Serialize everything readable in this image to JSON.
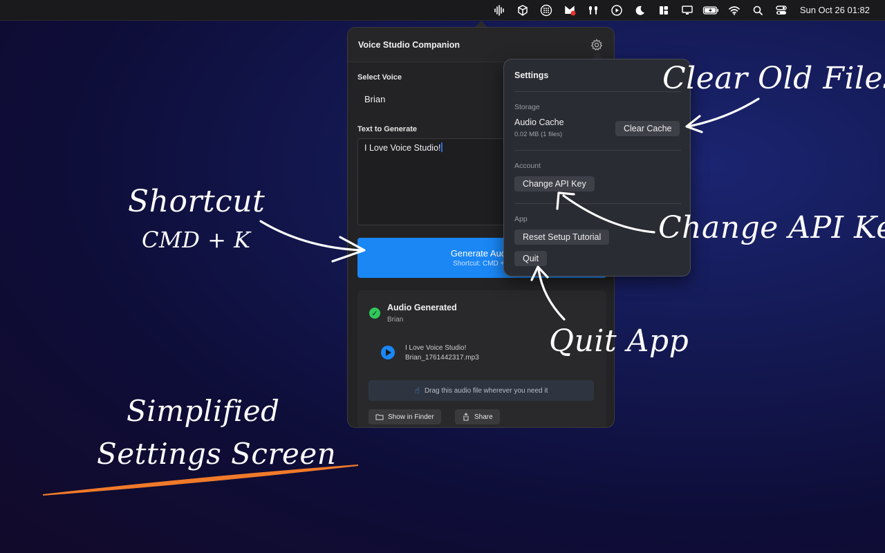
{
  "menubar": {
    "clock": "Sun Oct 26  01:82",
    "icons": [
      "waveform-icon",
      "cube-icon",
      "grid-icon",
      "app-icon",
      "airpods-icon",
      "play-circle-icon",
      "moon-icon",
      "layout-icon",
      "display-icon",
      "battery-icon",
      "wifi-icon",
      "search-icon",
      "control-center-icon"
    ]
  },
  "panel": {
    "title": "Voice Studio Companion",
    "select_label": "Select Voice",
    "voice": "Brian",
    "text_label": "Text to Generate",
    "text_value": "I Love Voice Studio!",
    "generate_label": "Generate Audio",
    "generate_sub": "Shortcut: CMD + K",
    "result": {
      "title": "Audio Generated",
      "voice": "Brian",
      "file_text": "I Love Voice Studio!",
      "file_name": "Brian_1761442317.mp3",
      "drag_hint": "Drag this audio file wherever you need it",
      "show_finder": "Show in Finder",
      "share": "Share"
    }
  },
  "settings": {
    "title": "Settings",
    "storage_label": "Storage",
    "cache_label": "Audio Cache",
    "cache_meta": "0.02 MB (1 files)",
    "clear_cache": "Clear Cache",
    "account_label": "Account",
    "change_api": "Change API Key",
    "app_label": "App",
    "reset_tutorial": "Reset Setup Tutorial",
    "quit": "Quit"
  },
  "annotations": {
    "clear_old": "Clear Old Files",
    "change_api": "Change API Key",
    "quit_app": "Quit App",
    "shortcut": "Shortcut",
    "shortcut_keys": "CMD + K",
    "simplified_1": "Simplified",
    "simplified_2": "Settings Screen"
  },
  "colors": {
    "accent": "#1a87f5",
    "success": "#30c85a",
    "underline": "#f07a2a"
  }
}
